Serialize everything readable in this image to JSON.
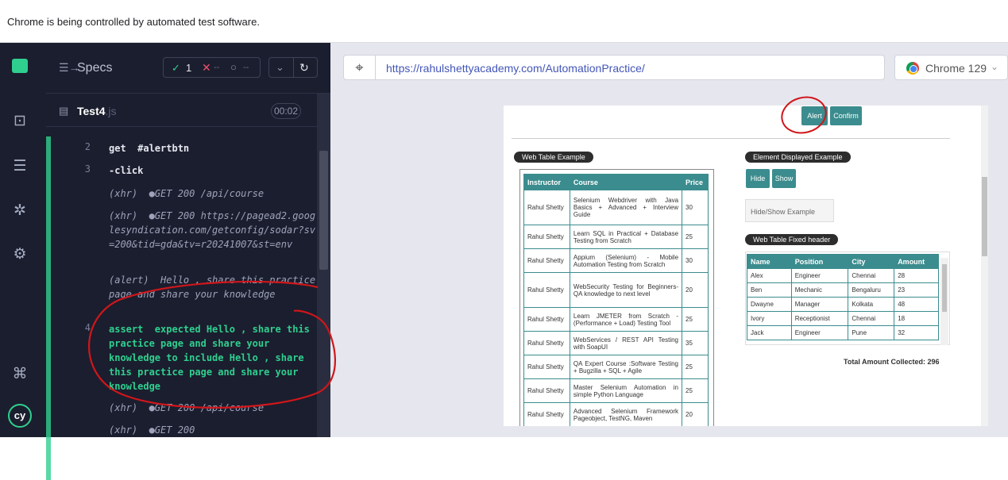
{
  "infobar": {
    "message": "Chrome is being controlled by automated test software."
  },
  "specs": {
    "title": "Specs",
    "pass_count": "1",
    "fail_count": "--",
    "pending_count": "--",
    "test_name": "Test4",
    "test_ext": ".js",
    "duration": "00:02"
  },
  "log": [
    {
      "num": "2",
      "text": "get  #alertbtn",
      "kind": "cmd"
    },
    {
      "num": "3",
      "text": "-click",
      "kind": "cmd"
    },
    {
      "num": "",
      "text": "(xhr)  ●GET 200 /api/course",
      "kind": "xhr"
    },
    {
      "num": "",
      "text": "(xhr)  ●GET 200 https://pagead2.googlesyndication.com/getconfig/sodar?sv=200&tid=gda&tv=r20241007&st=env",
      "kind": "xhr"
    },
    {
      "num": "",
      "text": "(alert)  Hello , share this practice page and share your knowledge",
      "kind": "alert"
    },
    {
      "num": "4",
      "text": "assert  expected Hello , share this practice page and share your knowledge to include Hello , share this practice page and share your knowledge",
      "kind": "assert"
    },
    {
      "num": "",
      "text": "(xhr)  ●GET 200 /api/course",
      "kind": "xhr"
    },
    {
      "num": "",
      "text": "(xhr)  ●GET 200",
      "kind": "xhr"
    }
  ],
  "url": "https://rahulshettyacademy.com/AutomationPractice/",
  "browser": "Chrome 129",
  "aut": {
    "alert_btn": "Alert",
    "confirm_btn": "Confirm",
    "web_table_label": "Web Table Example",
    "element_displayed_label": "Element Displayed Example",
    "hide_btn": "Hide",
    "show_btn": "Show",
    "hide_show_placeholder": "Hide/Show Example",
    "fixed_header_label": "Web Table Fixed header",
    "web_table": {
      "headers": [
        "Instructor",
        "Course",
        "Price"
      ],
      "rows": [
        [
          "Rahul Shetty",
          "Selenium Webdriver with Java Basics + Advanced + Interview Guide",
          "30"
        ],
        [
          "Rahul Shetty",
          "Learn SQL in Practical + Database Testing from Scratch",
          "25"
        ],
        [
          "Rahul Shetty",
          "Appium (Selenium) - Mobile Automation Testing from Scratch",
          "30"
        ],
        [
          "Rahul Shetty",
          "WebSecurity Testing for Beginners-QA knowledge to next level",
          "20"
        ],
        [
          "Rahul Shetty",
          "Learn JMETER from Scratch - (Performance + Load) Testing Tool",
          "25"
        ],
        [
          "Rahul Shetty",
          "WebServices / REST API Testing with SoapUI",
          "35"
        ],
        [
          "Rahul Shetty",
          "QA Expert Course :Software Testing + Bugzilla + SQL + Agile",
          "25"
        ],
        [
          "Rahul Shetty",
          "Master Selenium Automation in simple Python Language",
          "25"
        ],
        [
          "Rahul Shetty",
          "Advanced Selenium Framework Pageobject, TestNG, Maven",
          "20"
        ]
      ]
    },
    "fixed_table": {
      "headers": [
        "Name",
        "Position",
        "City",
        "Amount"
      ],
      "rows": [
        [
          "Alex",
          "Engineer",
          "Chennai",
          "28"
        ],
        [
          "Ben",
          "Mechanic",
          "Bengaluru",
          "23"
        ],
        [
          "Dwayne",
          "Manager",
          "Kolkata",
          "48"
        ],
        [
          "Ivory",
          "Receptionist",
          "Chennai",
          "18"
        ],
        [
          "Jack",
          "Engineer",
          "Pune",
          "32"
        ]
      ]
    },
    "total_amount": "Total Amount Collected: 296"
  }
}
